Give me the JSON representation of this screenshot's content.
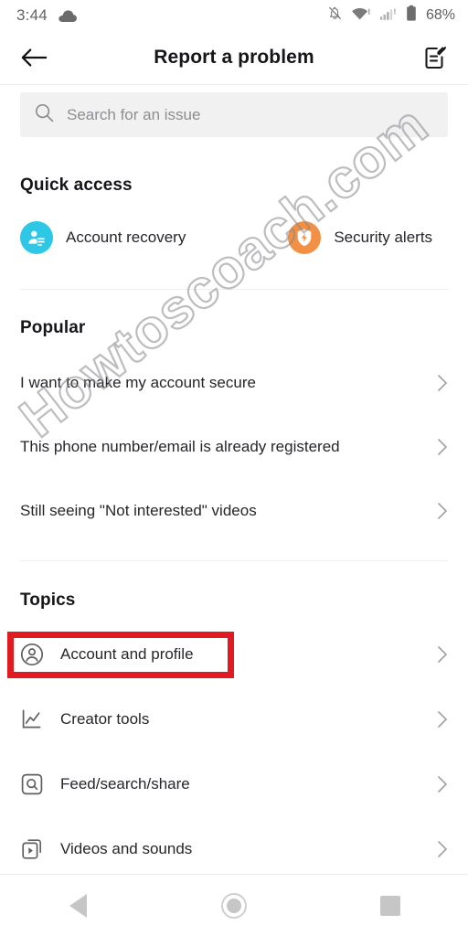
{
  "statusbar": {
    "time": "3:44",
    "cloud_icon": "cloud-icon",
    "mute_icon": "bell-off-icon",
    "wifi_icon": "wifi-icon",
    "signal_icon": "cellular-signal-icon",
    "battery_icon": "battery-icon",
    "battery_text": "68%"
  },
  "header": {
    "back_icon": "arrow-left-icon",
    "title": "Report a problem",
    "edit_icon": "report-edit-icon"
  },
  "search": {
    "icon": "search-icon",
    "placeholder": "Search for an issue",
    "value": ""
  },
  "quick_access": {
    "title": "Quick access",
    "items": [
      {
        "label": "Account recovery",
        "icon": "account-recovery-icon",
        "color": "#2ec8e6"
      },
      {
        "label": "Security alerts",
        "icon": "security-shield-icon",
        "color": "#f29045"
      }
    ]
  },
  "popular": {
    "title": "Popular",
    "items": [
      {
        "label": "I want to make my account secure",
        "chevron": "chevron-right-icon"
      },
      {
        "label": "This phone number/email is already registered",
        "chevron": "chevron-right-icon"
      },
      {
        "label": "Still seeing \"Not interested\" videos",
        "chevron": "chevron-right-icon"
      }
    ]
  },
  "topics": {
    "title": "Topics",
    "items": [
      {
        "label": "Account and profile",
        "icon": "person-circle-icon",
        "chevron": "chevron-right-icon",
        "highlighted": true
      },
      {
        "label": "Creator tools",
        "icon": "analytics-chart-icon",
        "chevron": "chevron-right-icon",
        "highlighted": false
      },
      {
        "label": "Feed/search/share",
        "icon": "search-square-icon",
        "chevron": "chevron-right-icon",
        "highlighted": false
      },
      {
        "label": "Videos and sounds",
        "icon": "video-stack-icon",
        "chevron": "chevron-right-icon",
        "highlighted": false
      }
    ]
  },
  "annotation": {
    "highlight_color": "#e11b22",
    "target": "Account and profile"
  },
  "watermark": {
    "text": "Howtoscoach.com"
  },
  "navbar": {
    "back": "nav-back-icon",
    "home": "nav-home-icon",
    "recents": "nav-recents-icon"
  }
}
